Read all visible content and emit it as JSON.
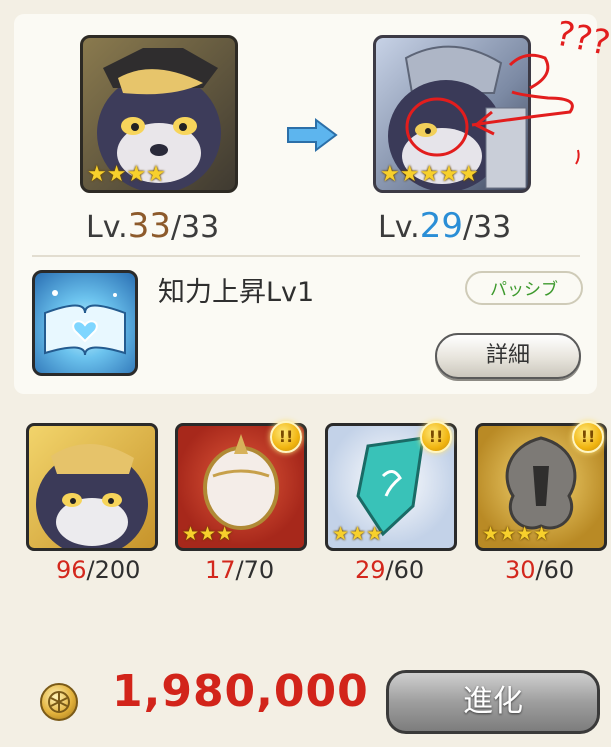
{
  "evolution": {
    "before": {
      "level_current": "33",
      "level_max": "/33",
      "level_prefix": "Lv.",
      "stars": "★★★★",
      "icon": "wolf-officer-portrait"
    },
    "after": {
      "level_current": "29",
      "level_max": "/33",
      "level_prefix": "Lv.",
      "stars": "★★★★★",
      "icon": "wolf-armored-portrait"
    },
    "arrow_icon": "right-arrow"
  },
  "skill": {
    "name": "知力上昇Lv1",
    "type_badge": "パッシブ",
    "detail_button": "詳細",
    "icon": "book-heart-icon"
  },
  "materials": [
    {
      "have": "96",
      "need": "/200",
      "stars": "",
      "icon": "wolf-material",
      "alert": false
    },
    {
      "have": "17",
      "need": "/70",
      "stars": "★★★",
      "icon": "orb-material",
      "alert": true,
      "alert_text": "!!"
    },
    {
      "have": "29",
      "need": "/60",
      "stars": "★★★",
      "icon": "crystal-material",
      "alert": true,
      "alert_text": "!!"
    },
    {
      "have": "30",
      "need": "/60",
      "stars": "★★★★",
      "icon": "crest-material",
      "alert": true,
      "alert_text": "!!"
    }
  ],
  "cost": {
    "amount": "1,980,000",
    "icon": "coin-icon"
  },
  "evolve_button": "進化",
  "annotations": {
    "scribble_text": "???"
  },
  "colors": {
    "highlight_red": "#d2241a",
    "level_blue": "#2a8ed6",
    "level_brown": "#8d5a2b",
    "passive_green": "#3e9a2e"
  }
}
